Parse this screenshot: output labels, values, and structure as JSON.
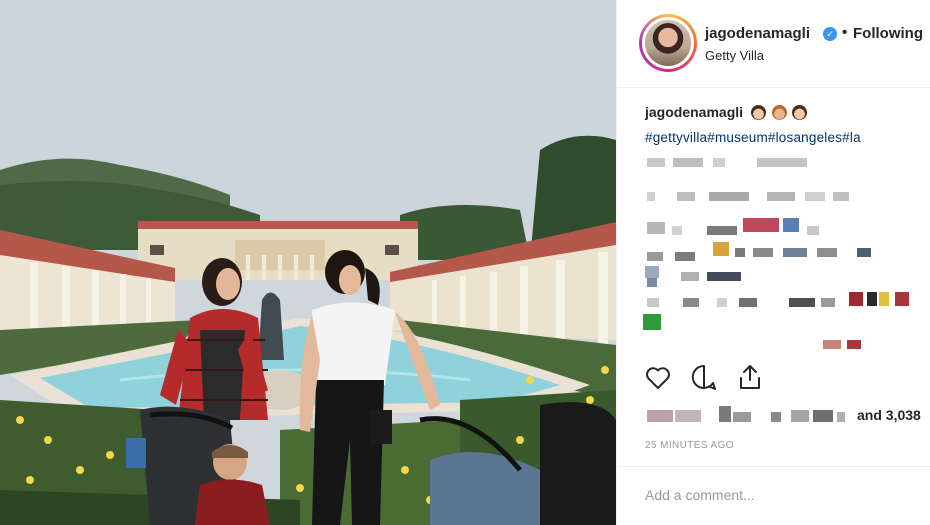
{
  "post": {
    "username": "jagodenamagli",
    "follow_status": "Following",
    "dot_separator": "•",
    "location": "Getty Villa",
    "verified_icon": "verified-badge-icon",
    "caption": {
      "username": "jagodenamagli",
      "emojis": [
        "woman-face-emoji",
        "woman-face-emoji",
        "woman-face-emoji"
      ],
      "hashtags": "#gettyvilla#museum#losangeles#la"
    },
    "actions": {
      "like_icon": "heart-icon",
      "comment_icon": "comment-bubble-icon",
      "share_icon": "share-icon"
    },
    "likes_suffix": "and 3,038",
    "timestamp": "25 MINUTES AGO",
    "comment_placeholder": "Add a comment..."
  },
  "colors": {
    "link": "#003569",
    "verified": "#3897f0",
    "muted": "#999999",
    "divider": "#efefef"
  }
}
